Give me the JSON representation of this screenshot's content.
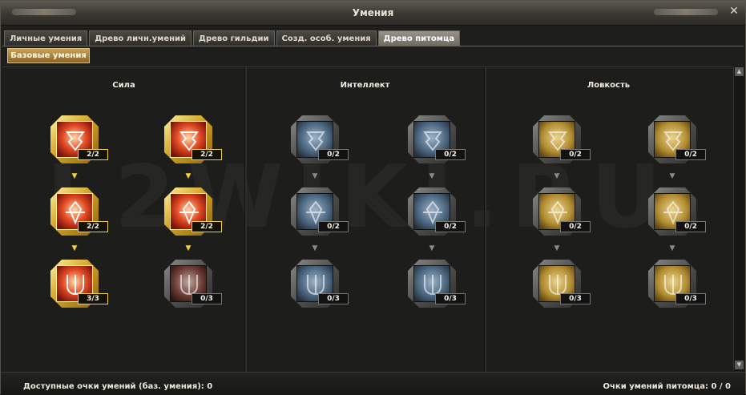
{
  "window": {
    "title": "Умения",
    "close": "✕"
  },
  "tabs": [
    {
      "label": "Личные умения",
      "active": false
    },
    {
      "label": "Древо личн.умений",
      "active": false
    },
    {
      "label": "Древо гильдии",
      "active": false
    },
    {
      "label": "Созд. особ. умения",
      "active": false
    },
    {
      "label": "Древо питомца",
      "active": true
    }
  ],
  "subtab": {
    "label": "Базовые умения"
  },
  "watermark": "L2WIKI.RU",
  "columns": [
    {
      "title": "Сила",
      "theme": "red",
      "skills": [
        [
          "2/2",
          "2/2",
          "3/3"
        ],
        [
          "2/2",
          "2/2",
          "0/3"
        ]
      ]
    },
    {
      "title": "Интеллект",
      "theme": "blue",
      "skills": [
        [
          "0/2",
          "0/2",
          "0/3"
        ],
        [
          "0/2",
          "0/2",
          "0/3"
        ]
      ]
    },
    {
      "title": "Ловкость",
      "theme": "yellow",
      "skills": [
        [
          "0/2",
          "0/2",
          "0/3"
        ],
        [
          "0/2",
          "0/2",
          "0/3"
        ]
      ]
    }
  ],
  "arrow_glyph": "▼",
  "scroll": {
    "up": "▲",
    "down": "▼"
  },
  "footer": {
    "available_points": "Доступные очки умений (баз. умения): 0",
    "pet_points": "Очки умений питомца: 0 / 0"
  },
  "colors": {
    "gold": "#f3d23a",
    "tab_active": "#8c887f",
    "subtab": "#b88f46"
  }
}
